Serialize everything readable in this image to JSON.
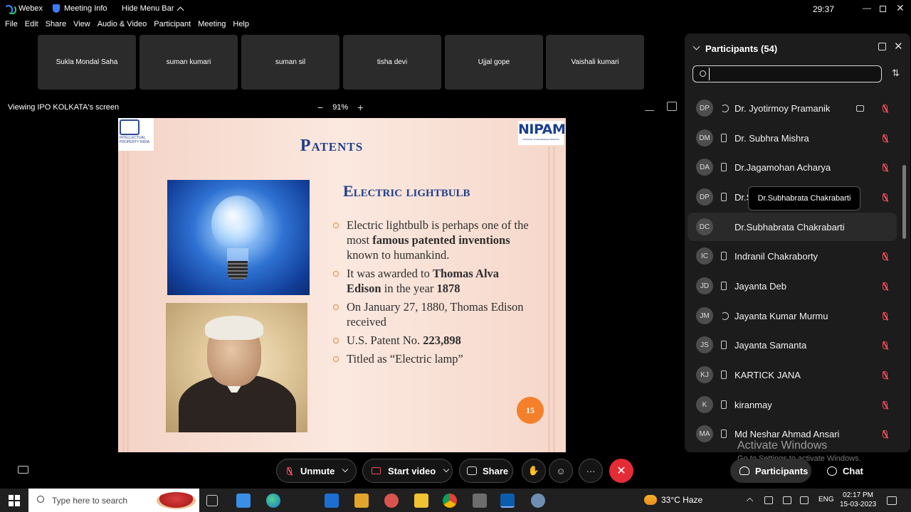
{
  "titlebar": {
    "app_name": "Webex",
    "meeting_info": "Meeting Info",
    "hide_menu": "Hide Menu Bar",
    "timer": "29:37"
  },
  "menu": [
    "File",
    "Edit",
    "Share",
    "View",
    "Audio & Video",
    "Participant",
    "Meeting",
    "Help"
  ],
  "tiles": [
    "Sukla Mondal Saha",
    "suman kumari",
    "suman sil",
    "tisha devi",
    "Ujjal gope",
    "Vaishali kumari"
  ],
  "viewing": {
    "label": "Viewing IPO KOLKATA's screen",
    "zoom": "91%",
    "zoom_out": "−",
    "zoom_in": "+"
  },
  "slide": {
    "ip_logo_text": "INTELLECTUAL PROPERTY INDIA",
    "nipam_logo": "NIPAM",
    "nipam_sub": "NATIONAL IP AWARENESS MISSION",
    "title": "Patents",
    "subtitle": "Electric lightbulb",
    "bullet1_a": "Electric lightbulb is perhaps one of the most ",
    "bullet1_b": "famous patented inventions",
    "bullet1_c": " known to humankind.",
    "bullet2_a": "It was awarded to ",
    "bullet2_b": "Thomas Alva Edison",
    "bullet2_c": " in the year ",
    "bullet2_d": "1878",
    "bullet3": "On January 27, 1880, Thomas Edison received",
    "bullet4_a": "U.S. Patent No. ",
    "bullet4_b": "223,898",
    "bullet5": "Titled as “Electric lamp”",
    "page_number": "15"
  },
  "panel": {
    "title": "Participants (54)",
    "search_value": "",
    "tooltip": "Dr.Subhabrata Chakrabarti",
    "participants": [
      {
        "initials": "DP",
        "name": "Dr. Jyotirmoy Pramanik"
      },
      {
        "initials": "DM",
        "name": "Dr. Subhra Mishra"
      },
      {
        "initials": "DA",
        "name": "Dr.Jagamohan Acharya"
      },
      {
        "initials": "DP",
        "name": "Dr.S"
      },
      {
        "initials": "DC",
        "name": "Dr.Subhabrata Chakrabarti"
      },
      {
        "initials": "IC",
        "name": "Indranil Chakraborty"
      },
      {
        "initials": "JD",
        "name": "Jayanta Deb"
      },
      {
        "initials": "JM",
        "name": "Jayanta Kumar Murmu"
      },
      {
        "initials": "JS",
        "name": "Jayanta Samanta"
      },
      {
        "initials": "KJ",
        "name": "KARTICK JANA"
      },
      {
        "initials": "K",
        "name": "kiranmay"
      },
      {
        "initials": "MA",
        "name": "Md Neshar Ahmad Ansari"
      }
    ]
  },
  "controls": {
    "unmute": "Unmute",
    "start_video": "Start video",
    "share": "Share",
    "more": "···",
    "participants": "Participants",
    "chat": "Chat"
  },
  "watermark": {
    "line1": "Activate Windows",
    "line2": "Go to Settings to activate Windows."
  },
  "taskbar": {
    "search_placeholder": "Type here to search",
    "weather": "33°C  Haze",
    "lang": "ENG",
    "time": "02:17 PM",
    "date": "15-03-2023"
  }
}
